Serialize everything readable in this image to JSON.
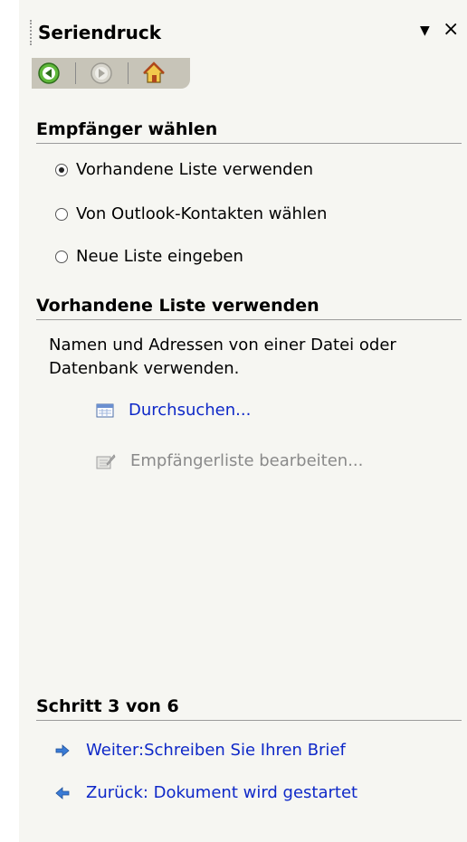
{
  "pane": {
    "title": "Seriendruck",
    "menu_arrow": "▼",
    "close": "×"
  },
  "nav": {
    "back_icon": "back-arrow-icon",
    "forward_icon": "forward-arrow-icon",
    "home_icon": "home-icon"
  },
  "recipients": {
    "heading": "Empfänger wählen",
    "options": [
      {
        "label": "Vorhandene Liste verwenden",
        "checked": true
      },
      {
        "label": "Von Outlook-Kontakten wählen",
        "checked": false
      },
      {
        "label": "Neue Liste eingeben",
        "checked": false
      }
    ]
  },
  "existing_list": {
    "heading": "Vorhandene Liste verwenden",
    "description": "Namen und Adressen von einer Datei oder Datenbank verwenden.",
    "browse_label": "Durchsuchen...",
    "edit_label": "Empfängerliste bearbeiten..."
  },
  "step": {
    "heading": "Schritt 3 von 6",
    "next_label": "Weiter:Schreiben Sie Ihren Brief",
    "back_label": "Zurück: Dokument wird gestartet"
  },
  "colors": {
    "link": "#0e28c8",
    "disabled": "#8a8a8a",
    "pane_bg": "#f6f6f2",
    "toolbar_bg": "#c7c4b8"
  }
}
